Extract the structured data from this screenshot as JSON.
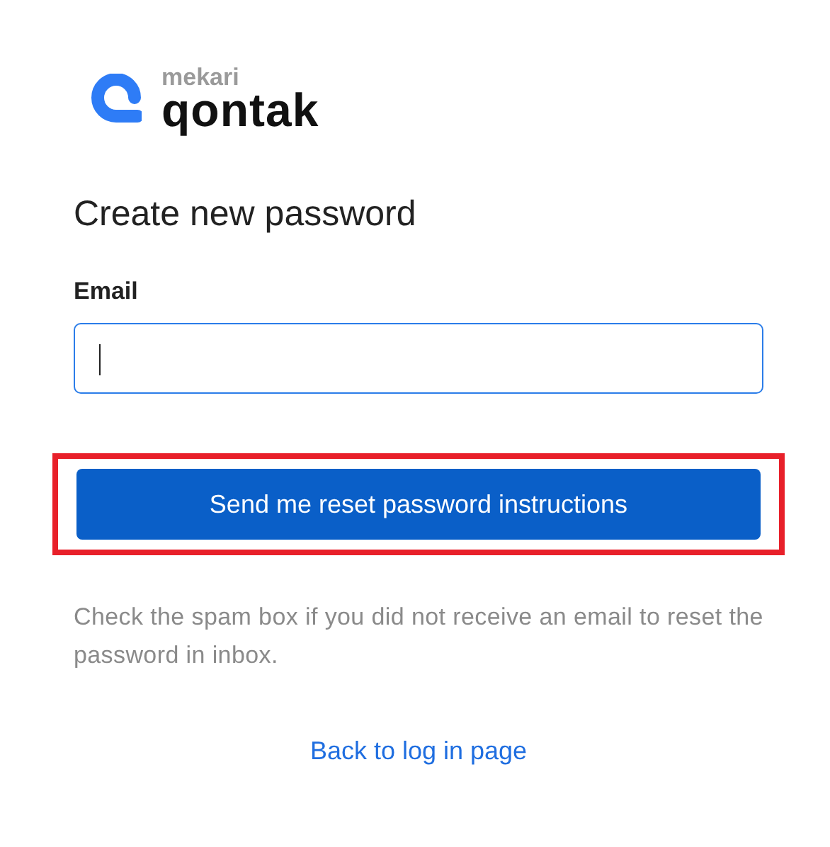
{
  "logo": {
    "brand": "mekari",
    "product": "qontak"
  },
  "title": "Create new password",
  "email": {
    "label": "Email",
    "focused": true
  },
  "submit": {
    "label": "Send me reset password instructions",
    "highlighted": true
  },
  "help": "Check the spam box if you did not receive an email to reset the password in inbox.",
  "back_link": "Back to log in page"
}
